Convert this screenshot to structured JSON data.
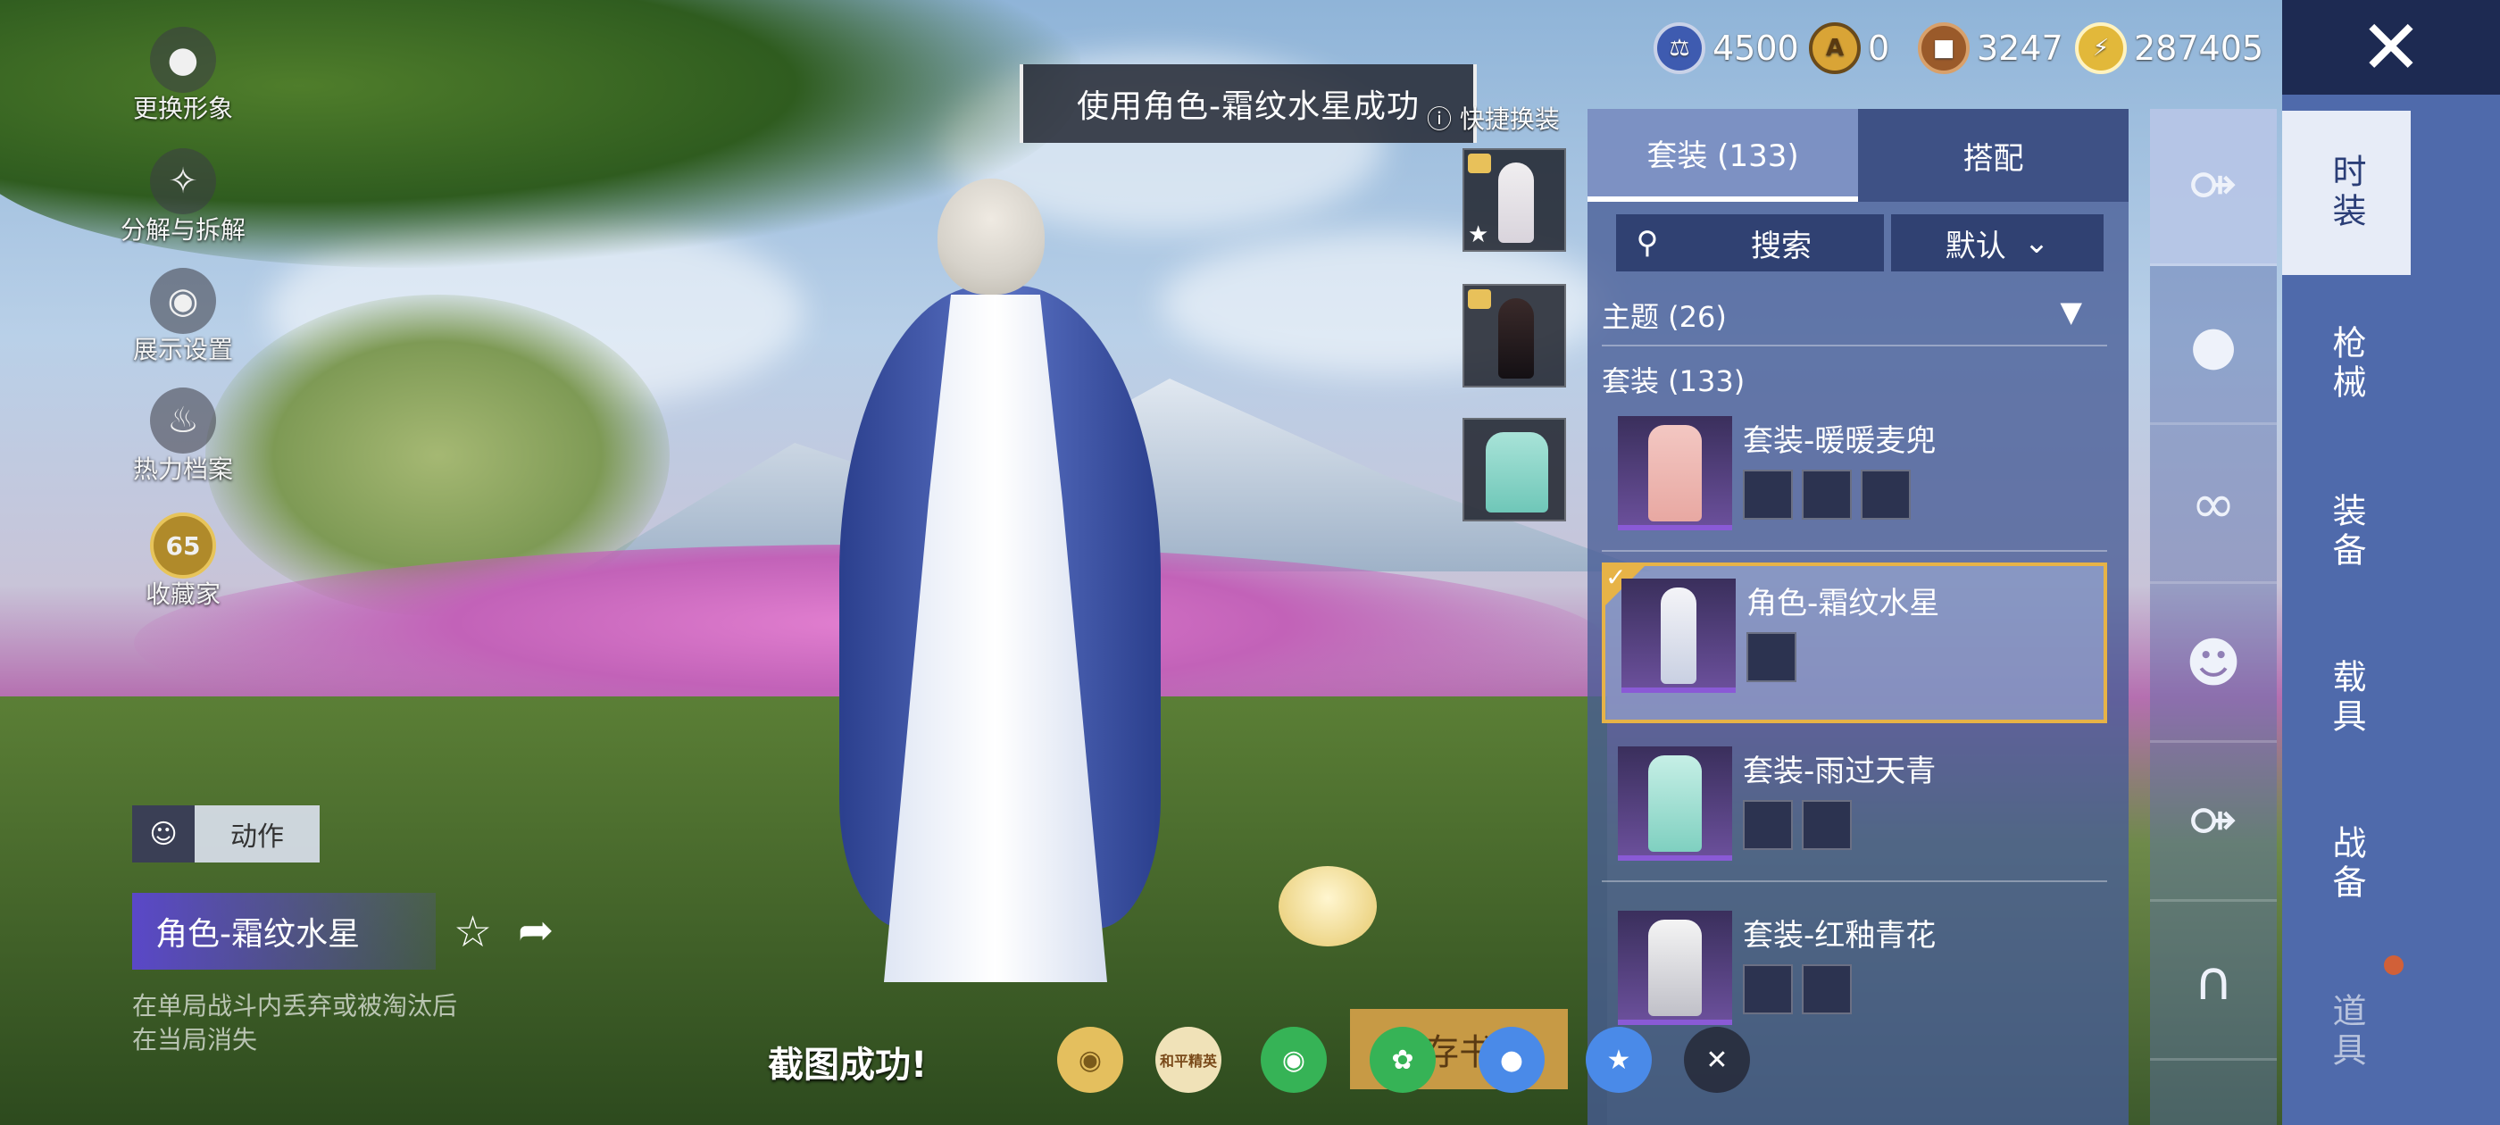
{
  "top_toast": "使用角色-霜纹水星成功",
  "quick_swap": {
    "title": "快捷换装",
    "help_icon": "help-icon"
  },
  "currencies": [
    {
      "icon": "coin-blue-icon",
      "value": "4500",
      "color": "#3e5bb0"
    },
    {
      "icon": "coin-gold-a-icon",
      "value": "0",
      "color": "#d9a436"
    },
    {
      "icon": "coin-bronze-icon",
      "value": "3247",
      "color": "#9a5a2a"
    },
    {
      "icon": "coin-lightning-icon",
      "value": "287405",
      "color": "#e2b83a"
    }
  ],
  "left_menu": [
    {
      "icon": "avatar-icon",
      "label": "更换形象"
    },
    {
      "icon": "puzzle-icon",
      "label": "分解与拆解"
    },
    {
      "icon": "eye-icon",
      "label": "展示设置"
    },
    {
      "icon": "fire-icon",
      "label": "热力档案"
    },
    {
      "icon": "level-badge-icon",
      "badge": "65",
      "label": "收藏家"
    }
  ],
  "panel": {
    "tabs": [
      "套装 (133)",
      "搭配"
    ],
    "search_placeholder": "搜索",
    "sort_label": "默认",
    "theme_section": "主题 (26)",
    "suit_section": "套装 (133)",
    "items": [
      {
        "name": "套装-暖暖麦兜",
        "sub_count": 3,
        "selected": false
      },
      {
        "name": "角色-霜纹水星",
        "sub_count": 1,
        "selected": true
      },
      {
        "name": "套装-雨过天青",
        "sub_count": 2,
        "selected": false
      },
      {
        "name": "套装-红釉青花",
        "sub_count": 2,
        "selected": false
      }
    ]
  },
  "categories": [
    "时装",
    "枪械",
    "装备",
    "载具",
    "战备",
    "道具"
  ],
  "sub_tabs": [
    "dress-icon",
    "cap-icon",
    "glasses-icon",
    "mask-icon",
    "dress-icon",
    "pants-icon"
  ],
  "bottom_left": {
    "action_label": "动作",
    "character_name": "角色-霜纹水星",
    "note_line1": "在单局战斗内丢弃或被淘汰后",
    "note_line2": "在当局消失"
  },
  "share_bar": {
    "message": "截图成功!",
    "store_button": "存书",
    "targets": [
      "peace-elite-circle",
      "peace-elite-app",
      "wechat",
      "moments",
      "qq",
      "qzone",
      "close"
    ],
    "brand_label": "和平精英"
  },
  "colors": {
    "accent_gold": "#e7b347",
    "panel_blue": "#4f6aab",
    "dark_navy": "#1d2a52"
  }
}
